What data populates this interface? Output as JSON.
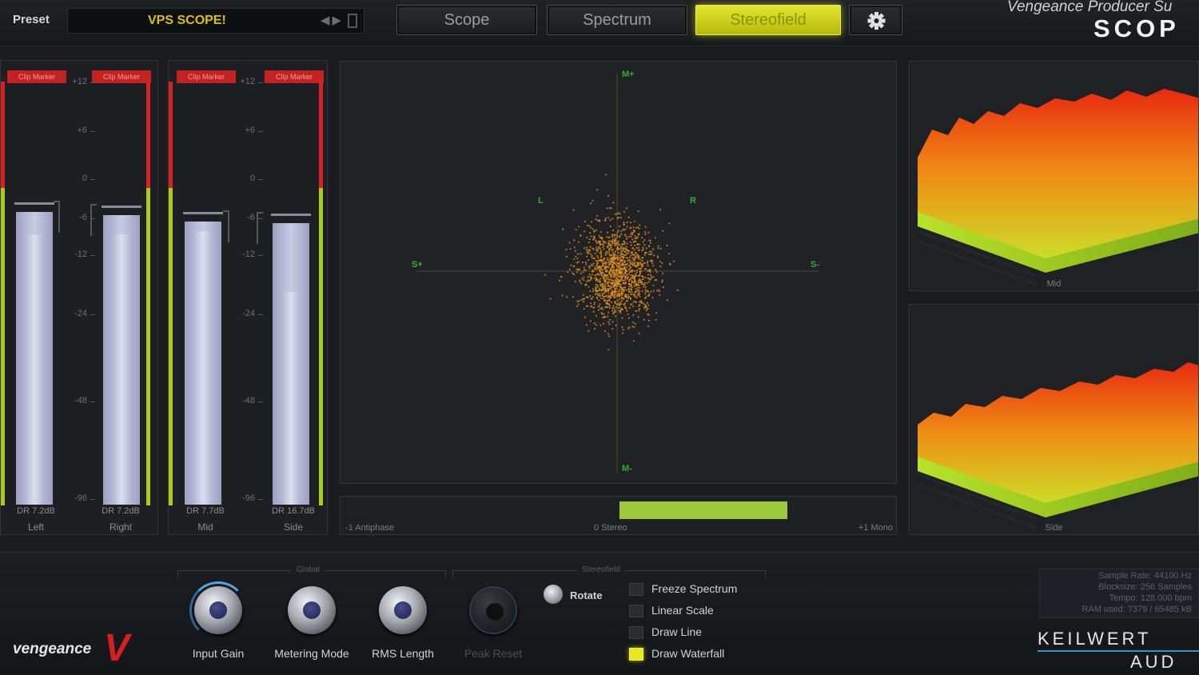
{
  "topbar": {
    "preset_label": "Preset",
    "preset_name": "VPS SCOPE!",
    "tabs": [
      {
        "label": "Scope",
        "active": false
      },
      {
        "label": "Spectrum",
        "active": false
      },
      {
        "label": "Stereofield",
        "active": true
      }
    ],
    "settings_icon": "gear-icon",
    "brand_title": "Vengeance Producer Su",
    "brand_scope": "SCOP"
  },
  "meters": {
    "clip_label": "Clip Marker",
    "ticks": [
      "+12",
      "+6",
      "0",
      "-6",
      "-12",
      "-24",
      "-48",
      "-96"
    ],
    "channels": [
      {
        "name": "Left",
        "dr": "DR 7.2dB",
        "level_db": -3.6
      },
      {
        "name": "Right",
        "dr": "DR 7.2dB",
        "level_db": -4.0
      },
      {
        "name": "Mid",
        "dr": "DR 7.7dB",
        "level_db": -5.0
      },
      {
        "name": "Side",
        "dr": "DR 16.7dB",
        "level_db": -5.3
      }
    ]
  },
  "stereofield": {
    "labels": {
      "mid_plus": "M+",
      "mid_minus": "M-",
      "left": "L",
      "right": "R",
      "side_plus": "S+",
      "side_minus": "S-"
    },
    "correlation": {
      "left_label": "-1 Antiphase",
      "center_label": "0 Stereo",
      "right_label": "+1 Mono",
      "value_from": 0.0,
      "value_to": 0.61
    }
  },
  "waterfalls": [
    {
      "label": "Mid"
    },
    {
      "label": "Side"
    }
  ],
  "controls": {
    "global_title": "Global",
    "stereofield_title": "Stereofield",
    "knobs": [
      {
        "label": "Input Gain"
      },
      {
        "label": "Metering Mode"
      },
      {
        "label": "RMS Length"
      },
      {
        "label": "Peak Reset"
      }
    ],
    "rotate_label": "Rotate",
    "checkboxes": [
      {
        "label": "Freeze Spectrum",
        "checked": false
      },
      {
        "label": "Linear Scale",
        "checked": false
      },
      {
        "label": "Draw Line",
        "checked": false
      },
      {
        "label": "Draw Waterfall",
        "checked": true
      }
    ]
  },
  "info": {
    "rows": [
      "Sample Rate: 44100 Hz",
      "Blocksize: 256 Samples",
      "Tempo: 128.000 bpm",
      "RAM used: 7379 / 65485 kB"
    ]
  },
  "branding": {
    "vengeance": "vengeance",
    "vengeance_mark": "V",
    "keilwerth": "KEILWERT",
    "audio": "AUD"
  },
  "colors": {
    "accent_yellow": "#e3e630",
    "clip_red": "#c42222",
    "meter_green": "#a8cc18",
    "axis_green": "#2db42d",
    "scatter_orange": "#e3901e",
    "keilwerth_blue": "#3a90c8"
  }
}
